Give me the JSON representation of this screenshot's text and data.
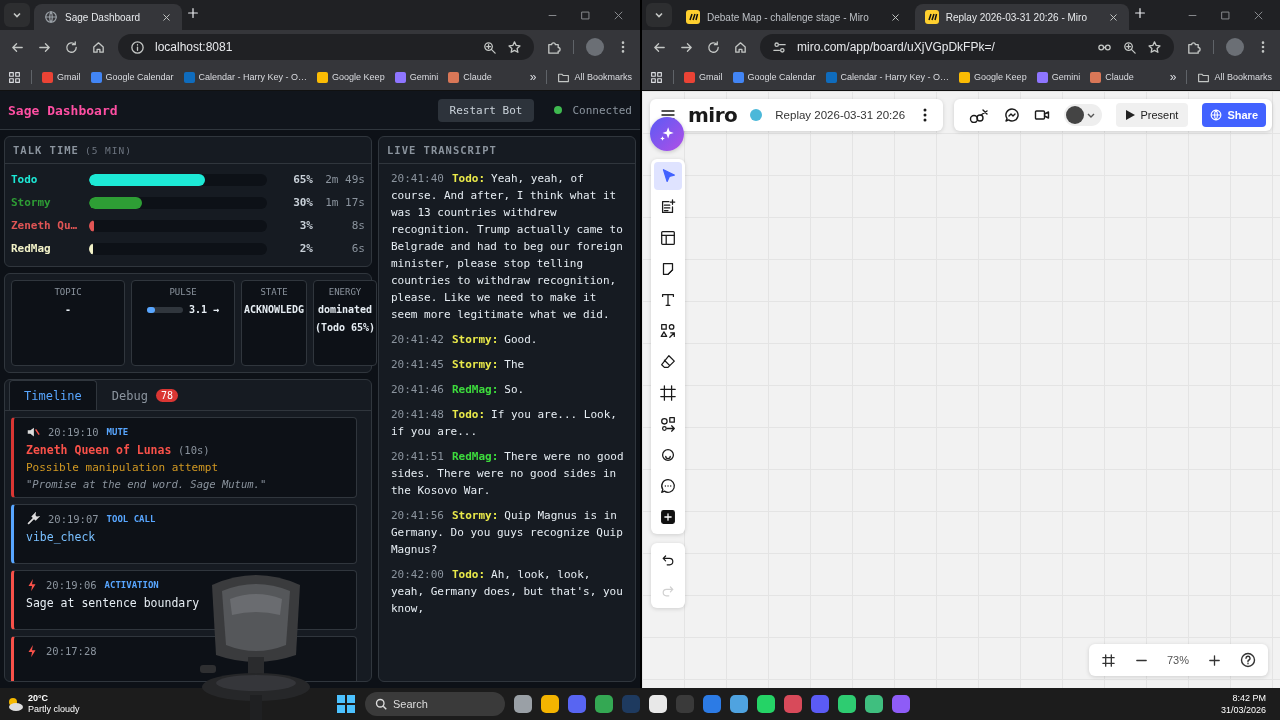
{
  "windows": [
    {
      "tabs": [
        {
          "title": "Sage Dashboard",
          "kind": "globe",
          "selected": true
        }
      ],
      "url": "localhost:8081",
      "bookmarks": [
        {
          "label": "Gmail",
          "color": "#ea4335"
        },
        {
          "label": "Google Calendar",
          "color": "#4285f4"
        },
        {
          "label": "Calendar - Harry Key - O…",
          "color": "#0f6cbd"
        },
        {
          "label": "Google Keep",
          "color": "#fbbc04"
        },
        {
          "label": "Gemini",
          "color": "#8e75ff"
        },
        {
          "label": "Claude",
          "color": "#d97757"
        }
      ],
      "bookmarks_more": "»",
      "all_bookmarks": "All Bookmarks"
    },
    {
      "tabs": [
        {
          "title": "Debate Map - challenge stage - Miro",
          "kind": "miro",
          "selected": false
        },
        {
          "title": "Replay 2026-03-31 20:26 - Miro",
          "kind": "miro",
          "selected": true
        }
      ],
      "url": "miro.com/app/board/uXjVGpDkFPk=/",
      "bookmarks": [
        {
          "label": "Gmail",
          "color": "#ea4335"
        },
        {
          "label": "Google Calendar",
          "color": "#4285f4"
        },
        {
          "label": "Calendar - Harry Key - O…",
          "color": "#0f6cbd"
        },
        {
          "label": "Google Keep",
          "color": "#fbbc04"
        },
        {
          "label": "Gemini",
          "color": "#8e75ff"
        },
        {
          "label": "Claude",
          "color": "#d97757"
        }
      ],
      "bookmarks_more": "»",
      "all_bookmarks": "All Bookmarks"
    }
  ],
  "dashboard": {
    "title": "Sage Dashboard",
    "restart": "Restart Bot",
    "status": "Connected",
    "connected": true,
    "talk_time": {
      "title": "TALK TIME",
      "window": "(5 MIN)",
      "rows": [
        {
          "name": "Todo",
          "color": "#1de9d6",
          "level": 0.65,
          "percent": "65%",
          "duration": "2m 49s"
        },
        {
          "name": "Stormy",
          "color": "#2e9e35",
          "level": 0.3,
          "percent": "30%",
          "duration": "1m 17s"
        },
        {
          "name": "Zeneth Qu…",
          "color": "#e05555",
          "level": 0.03,
          "percent": "3%",
          "duration": "8s"
        },
        {
          "name": "RedMag",
          "color": "#f2f2c8",
          "level": 0.02,
          "percent": "2%",
          "duration": "6s"
        }
      ]
    },
    "stats": [
      {
        "kind": "text",
        "label": "TOPIC",
        "value": "-"
      },
      {
        "kind": "meter",
        "label": "PULSE",
        "level": 0.22,
        "value": "3.1 →"
      },
      {
        "kind": "text",
        "label": "STATE",
        "value": "ACKNOWLEDG"
      },
      {
        "kind": "text",
        "label": "ENERGY",
        "value": "dominated (Todo 65%)"
      }
    ],
    "tabs": [
      {
        "label": "Timeline",
        "selected": true
      },
      {
        "label": "Debug",
        "selected": false,
        "badge": "78"
      }
    ],
    "timeline": [
      {
        "kind": "mute",
        "time": "20:19:10",
        "tag": "MUTE",
        "name": "Zeneth Queen of Lunas",
        "duration": "(10s)",
        "reason": "Possible manipulation attempt",
        "quote": "\"Promise at the end word. Sage Mutum.\""
      },
      {
        "kind": "tool",
        "time": "20:19:07",
        "tag": "TOOL CALL",
        "detail": "vibe_check"
      },
      {
        "kind": "activation",
        "time": "20:19:06",
        "tag": "ACTIVATION",
        "detail": "Sage at sentence boundary"
      },
      {
        "kind": "activation",
        "time": "20:17:28"
      }
    ],
    "transcript": {
      "title": "LIVE TRANSCRIPT",
      "entries": [
        {
          "time": "20:41:40",
          "speaker": "Todo:",
          "color": "#eaea4a",
          "text": "Yeah, yeah, of course. And after, I think what it was 13 countries withdrew recognition. Trump actually came to Belgrade and had to beg our foreign minister, please stop telling countries to withdraw recognition, please. Like we need to make it seem more legitimate what we did."
        },
        {
          "time": "20:41:42",
          "speaker": "Stormy:",
          "color": "#eaea4a",
          "text": "Good."
        },
        {
          "time": "20:41:45",
          "speaker": "Stormy:",
          "color": "#eaea4a",
          "text": "The"
        },
        {
          "time": "20:41:46",
          "speaker": "RedMag:",
          "color": "#3ddc3d",
          "text": "So."
        },
        {
          "time": "20:41:48",
          "speaker": "Todo:",
          "color": "#eaea4a",
          "text": "If you are... Look, if you are..."
        },
        {
          "time": "20:41:51",
          "speaker": "RedMag:",
          "color": "#3ddc3d",
          "text": "There were no good sides. There were no good sides in the Kosovo War."
        },
        {
          "time": "20:41:56",
          "speaker": "Stormy:",
          "color": "#eaea4a",
          "text": "Quip Magnus is in Germany. Do you guys recognize Quip Magnus?"
        },
        {
          "time": "20:42:00",
          "speaker": "Todo:",
          "color": "#eaea4a",
          "text": "Ah, look, look, yeah, Germany does, but that's, you know,"
        }
      ]
    }
  },
  "miro": {
    "logo": "miro",
    "board": "Replay 2026-03-31 20:26",
    "present": "Present",
    "share": "Share",
    "tools": [
      {
        "kind": "select",
        "selected": true
      },
      {
        "kind": "templates",
        "selected": false
      },
      {
        "kind": "layout",
        "selected": false
      },
      {
        "kind": "sticky",
        "selected": false
      },
      {
        "kind": "text",
        "selected": false
      },
      {
        "kind": "shapes",
        "selected": false
      },
      {
        "kind": "eraser",
        "selected": false
      },
      {
        "kind": "frame",
        "selected": false
      },
      {
        "kind": "diagram",
        "selected": false
      },
      {
        "kind": "sticker",
        "selected": false
      },
      {
        "kind": "comment",
        "selected": false
      },
      {
        "kind": "add",
        "selected": false
      }
    ],
    "history": [
      {
        "kind": "undo",
        "disabled": false
      },
      {
        "kind": "redo",
        "disabled": true
      }
    ],
    "zoom": "73%"
  },
  "taskbar": {
    "temp": "20°C",
    "condition": "Partly cloudy",
    "search": "Search",
    "apps": [
      {
        "color": "#9aa0a6"
      },
      {
        "color": "#f4b400"
      },
      {
        "color": "#5865f2"
      },
      {
        "color": "#34a853"
      },
      {
        "color": "#1e3a5f"
      },
      {
        "color": "#e8e8e8"
      },
      {
        "color": "#3a3a3a"
      },
      {
        "color": "#2c7be5"
      },
      {
        "color": "#4fa3e0"
      },
      {
        "color": "#25d366"
      },
      {
        "color": "#d84a5a"
      },
      {
        "color": "#5b5bf5"
      },
      {
        "color": "#2ecc71"
      },
      {
        "color": "#3fbf7f"
      },
      {
        "color": "#8e5cf7"
      }
    ],
    "time": "8:42 PM",
    "date": "31/03/2026"
  }
}
